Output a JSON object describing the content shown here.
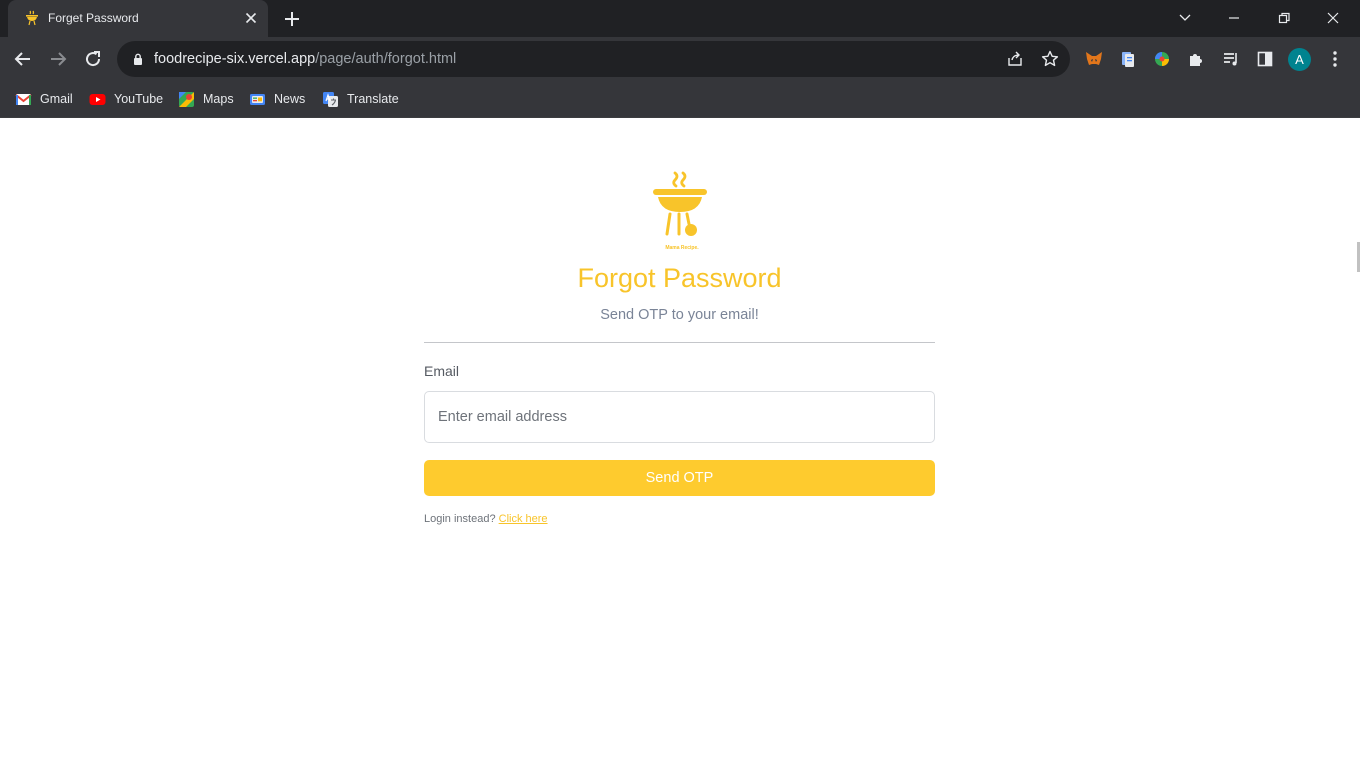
{
  "tab": {
    "title": "Forget Password",
    "favicon": "recipe-logo-icon"
  },
  "address_bar": {
    "domain": "foodrecipe-six.vercel.app",
    "path": "/page/auth/forgot.html"
  },
  "profile": {
    "initial": "A"
  },
  "bookmarks": [
    {
      "label": "Gmail",
      "icon": "gmail-icon"
    },
    {
      "label": "YouTube",
      "icon": "youtube-icon"
    },
    {
      "label": "Maps",
      "icon": "maps-icon"
    },
    {
      "label": "News",
      "icon": "news-icon"
    },
    {
      "label": "Translate",
      "icon": "translate-icon"
    }
  ],
  "page": {
    "logo_text": "Mama Recipe.",
    "title": "Forgot Password",
    "subtitle": "Send OTP to your email!",
    "email_label": "Email",
    "email_placeholder": "Enter email address",
    "email_value": "",
    "submit_label": "Send OTP",
    "login_prompt": "Login instead?",
    "login_link": "Click here"
  },
  "colors": {
    "accent": "#f8c42a",
    "button": "#fecb2e",
    "chrome_dark": "#202124",
    "chrome": "#35363a"
  }
}
